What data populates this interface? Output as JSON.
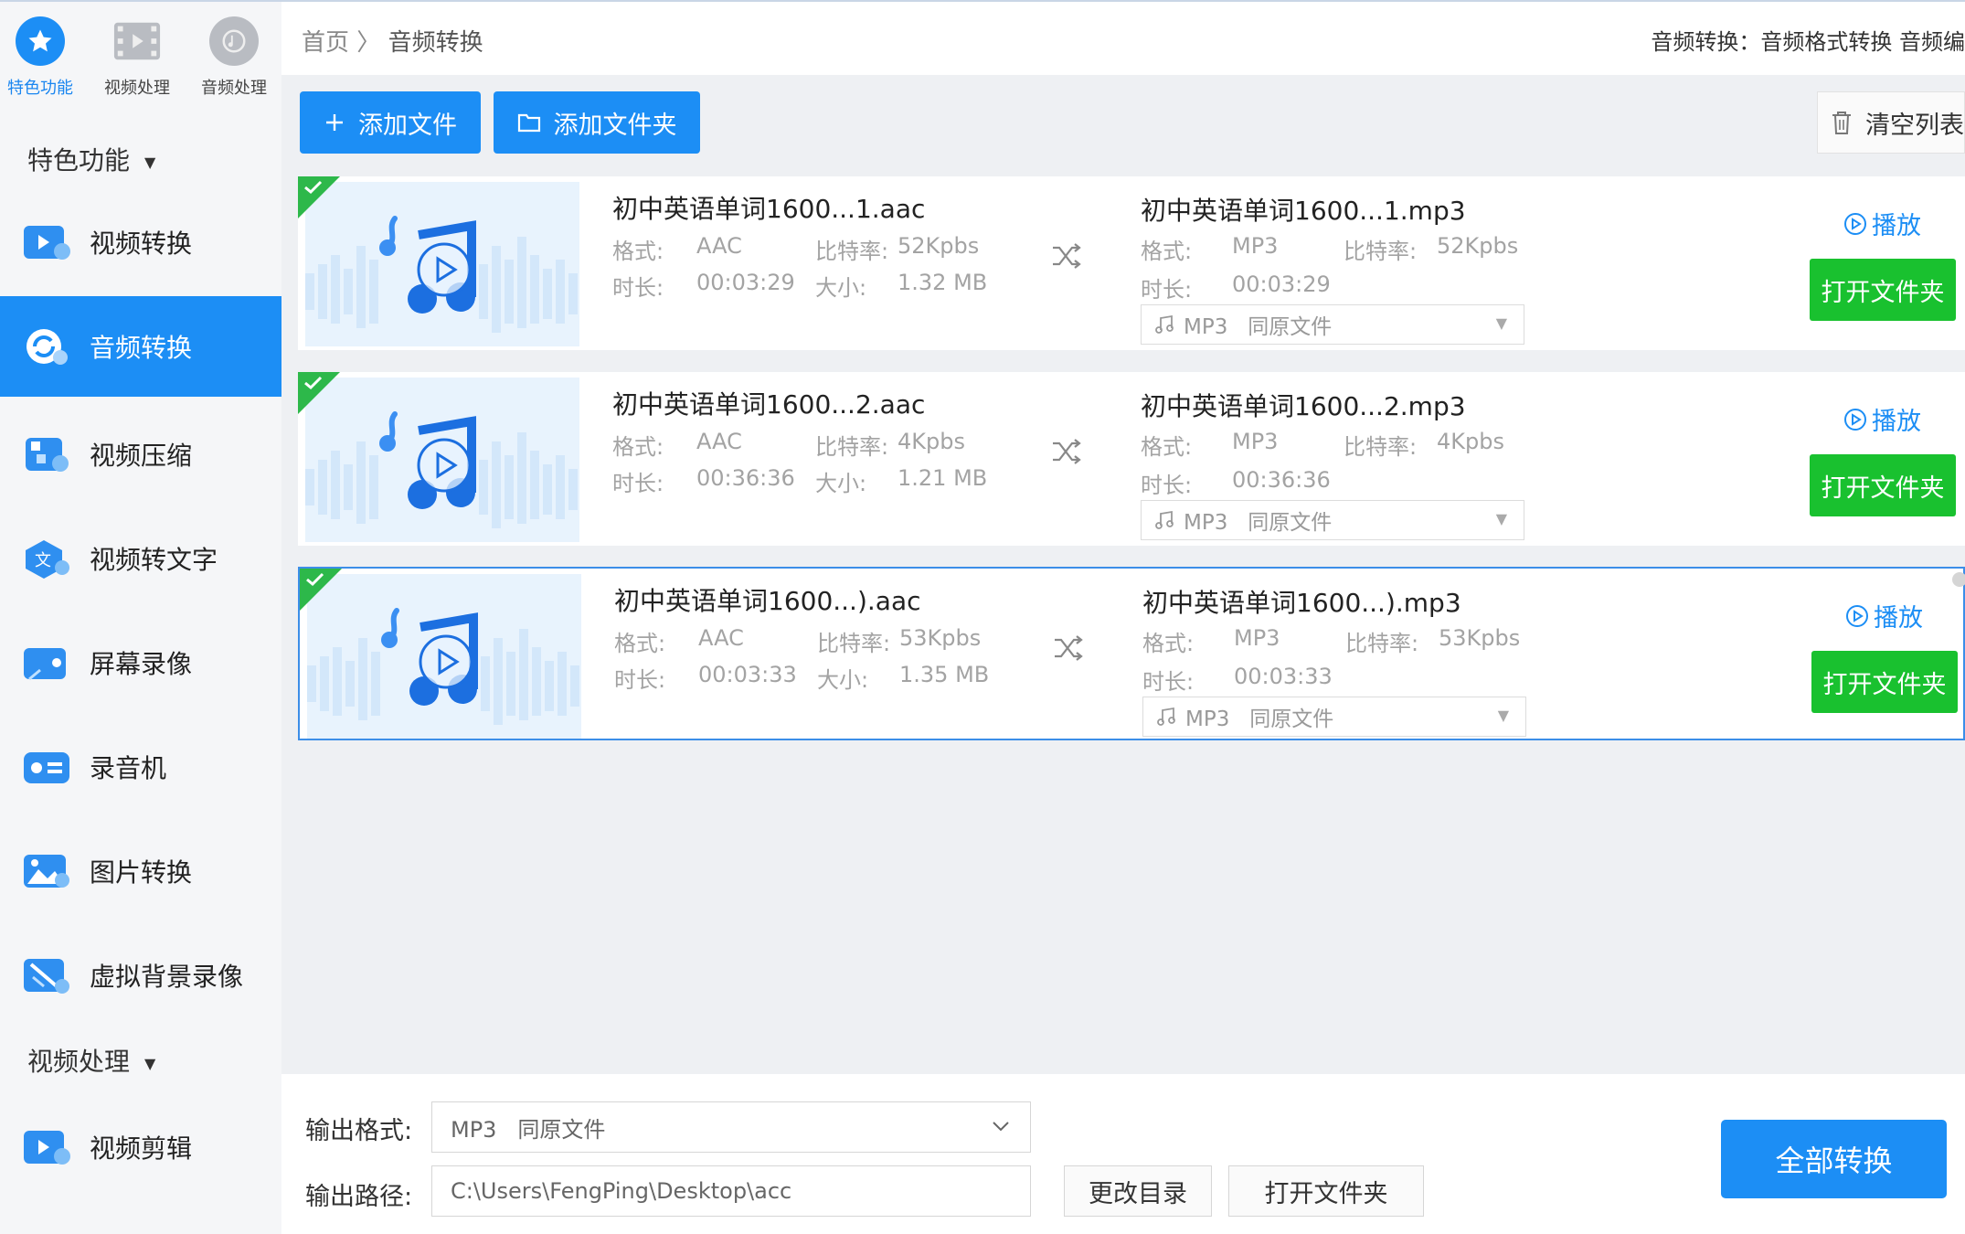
{
  "sidebar": {
    "top_tabs": [
      {
        "label": "特色功能",
        "icon": "star-icon",
        "active": true
      },
      {
        "label": "视频处理",
        "icon": "film-icon",
        "active": false
      },
      {
        "label": "音频处理",
        "icon": "music-disc-icon",
        "active": false
      }
    ],
    "section1": {
      "title": "特色功能",
      "caret": "▼"
    },
    "items": [
      {
        "label": "视频转换",
        "icon": "video-convert-icon"
      },
      {
        "label": "音频转换",
        "icon": "audio-convert-icon",
        "active": true
      },
      {
        "label": "视频压缩",
        "icon": "video-compress-icon"
      },
      {
        "label": "视频转文字",
        "icon": "video-to-text-icon"
      },
      {
        "label": "屏幕录像",
        "icon": "screen-record-icon"
      },
      {
        "label": "录音机",
        "icon": "recorder-icon"
      },
      {
        "label": "图片转换",
        "icon": "image-convert-icon"
      },
      {
        "label": "虚拟背景录像",
        "icon": "virtual-background-icon"
      }
    ],
    "section2": {
      "title": "视频处理",
      "caret": "▼"
    },
    "items2": [
      {
        "label": "视频剪辑",
        "icon": "video-edit-icon"
      }
    ]
  },
  "header": {
    "breadcrumb_home": "首页",
    "breadcrumb_sep": "〉",
    "breadcrumb_current": "音频转换",
    "info": "音频转换：音频格式转换 音频编"
  },
  "toolbar": {
    "add_file": "添加文件",
    "add_folder": "添加文件夹",
    "clear_list": "清空列表"
  },
  "labels": {
    "format": "格式:",
    "bitrate": "比特率:",
    "duration": "时长:",
    "size": "大小:",
    "play": "播放",
    "open_folder": "打开文件夹"
  },
  "files": [
    {
      "src_name": "初中英语单词1600...1.aac",
      "src_format": "AAC",
      "src_bitrate": "52Kpbs",
      "src_duration": "00:03:29",
      "src_size": "1.32 MB",
      "dst_name": "初中英语单词1600...1.mp3",
      "dst_format": "MP3",
      "dst_bitrate": "52Kpbs",
      "dst_duration": "00:03:29",
      "dst_option": "MP3   同原文件",
      "selected": false
    },
    {
      "src_name": "初中英语单词1600...2.aac",
      "src_format": "AAC",
      "src_bitrate": "4Kpbs",
      "src_duration": "00:36:36",
      "src_size": "1.21 MB",
      "dst_name": "初中英语单词1600...2.mp3",
      "dst_format": "MP3",
      "dst_bitrate": "4Kpbs",
      "dst_duration": "00:36:36",
      "dst_option": "MP3   同原文件",
      "selected": false
    },
    {
      "src_name": "初中英语单词1600...).aac",
      "src_format": "AAC",
      "src_bitrate": "53Kpbs",
      "src_duration": "00:03:33",
      "src_size": "1.35 MB",
      "dst_name": "初中英语单词1600...).mp3",
      "dst_format": "MP3",
      "dst_bitrate": "53Kpbs",
      "dst_duration": "00:03:33",
      "dst_option": "MP3   同原文件",
      "selected": true
    }
  ],
  "bottom": {
    "output_format_label": "输出格式:",
    "output_format_value": "MP3   同原文件",
    "output_path_label": "输出路径:",
    "output_path_value": "C:\\Users\\FengPing\\Desktop\\acc",
    "change_dir": "更改目录",
    "open_folder": "打开文件夹",
    "convert_all": "全部转换"
  },
  "colors": {
    "accent": "#1c8ef5",
    "green": "#19c12f",
    "check_green": "#2db84a"
  }
}
